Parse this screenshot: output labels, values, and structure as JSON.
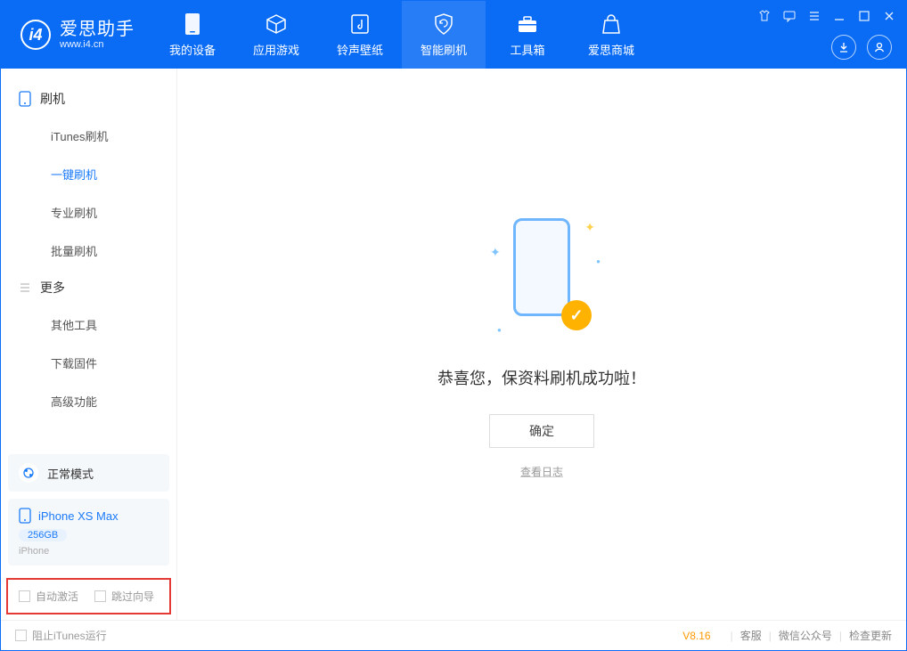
{
  "app": {
    "title": "爱思助手",
    "subtitle": "www.i4.cn"
  },
  "nav": {
    "items": [
      {
        "label": "我的设备"
      },
      {
        "label": "应用游戏"
      },
      {
        "label": "铃声壁纸"
      },
      {
        "label": "智能刷机"
      },
      {
        "label": "工具箱"
      },
      {
        "label": "爱思商城"
      }
    ]
  },
  "sidebar": {
    "section1_title": "刷机",
    "section1": [
      {
        "label": "iTunes刷机"
      },
      {
        "label": "一键刷机"
      },
      {
        "label": "专业刷机"
      },
      {
        "label": "批量刷机"
      }
    ],
    "section2_title": "更多",
    "section2": [
      {
        "label": "其他工具"
      },
      {
        "label": "下载固件"
      },
      {
        "label": "高级功能"
      }
    ],
    "mode_label": "正常模式",
    "device_name": "iPhone XS Max",
    "device_storage": "256GB",
    "device_type": "iPhone",
    "opt_auto_activate": "自动激活",
    "opt_skip_guide": "跳过向导"
  },
  "main": {
    "success_message": "恭喜您，保资料刷机成功啦！",
    "ok_button": "确定",
    "view_log": "查看日志"
  },
  "statusbar": {
    "block_itunes": "阻止iTunes运行",
    "version": "V8.16",
    "links": [
      "客服",
      "微信公众号",
      "检查更新"
    ]
  }
}
